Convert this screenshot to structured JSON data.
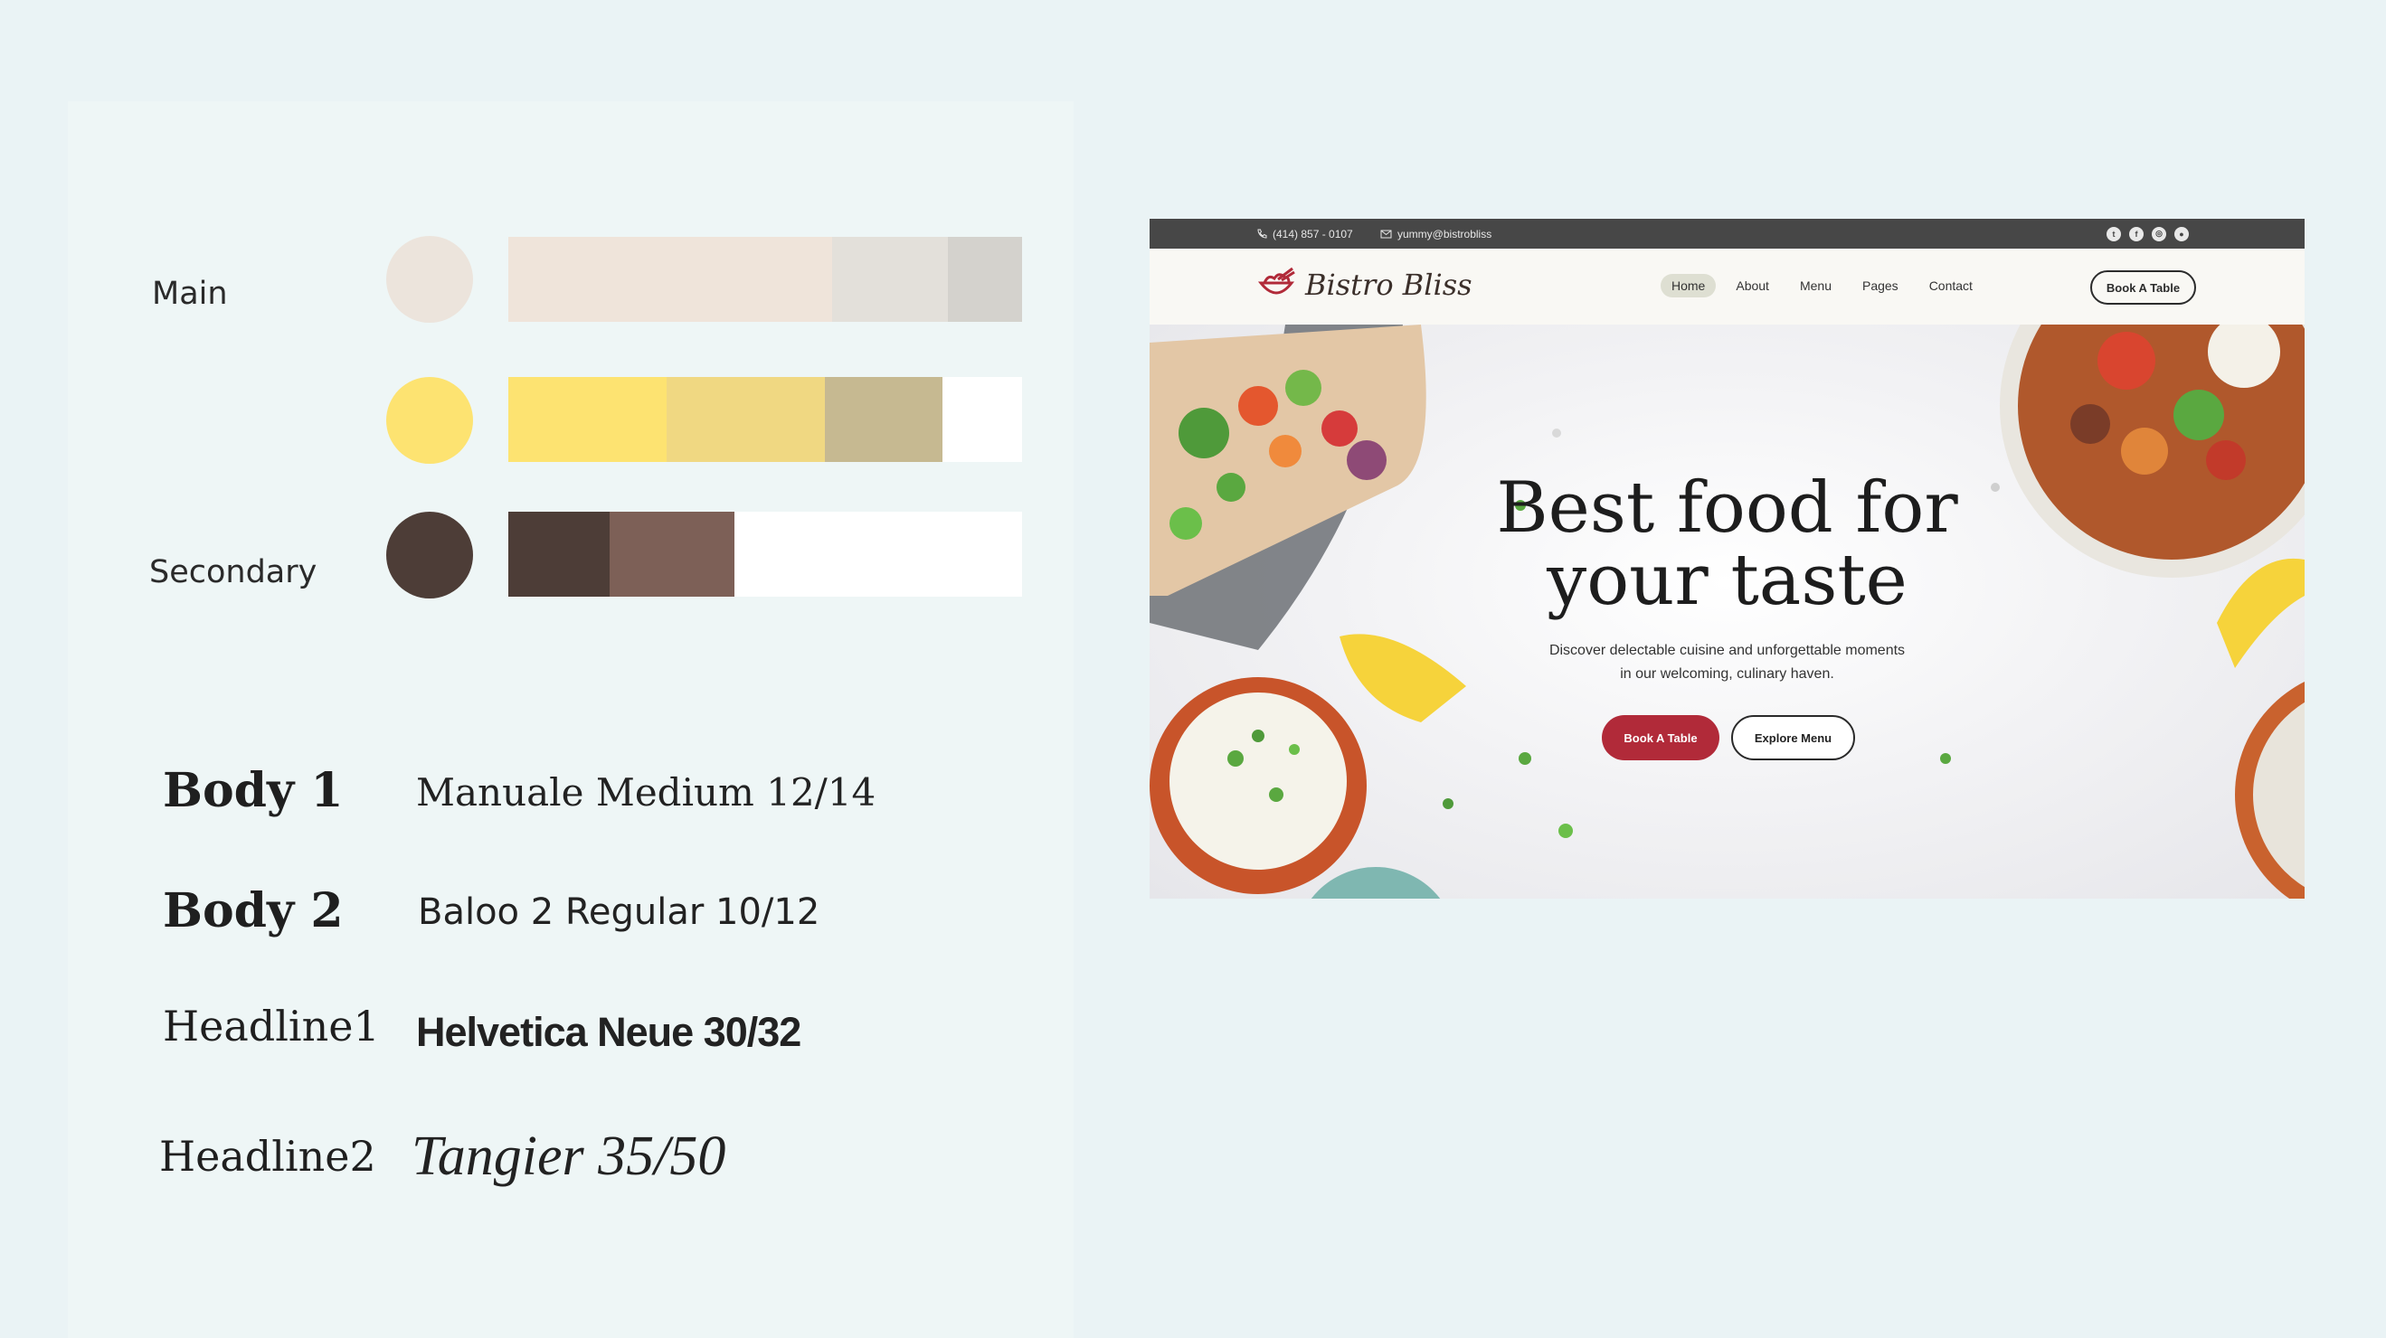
{
  "palette": {
    "main_label": "Main",
    "secondary_label": "Secondary",
    "rows": [
      {
        "circle": "#ece4dc",
        "swatches": [
          "#efe4da",
          "#e3e0da",
          "#d4d2cd"
        ]
      },
      {
        "circle": "#fde371",
        "swatches": [
          "#fde371",
          "#f0d882",
          "#c6b991",
          "#ffffff"
        ]
      },
      {
        "circle": "#4d3d37",
        "swatches": [
          "#4d3d37",
          "#7d6057",
          "#ffffff"
        ]
      }
    ]
  },
  "typography": [
    {
      "name": "Body 1",
      "spec": "Manuale Medium 12/14"
    },
    {
      "name": "Body 2",
      "spec": "Baloo 2 Regular 10/12"
    },
    {
      "name": "Headline1",
      "spec": "Helvetica Neue 30/32"
    },
    {
      "name": "Headline2",
      "spec": "Tangier 35/50"
    }
  ],
  "website": {
    "topbar": {
      "phone": "(414) 857 - 0107",
      "email": "yummy@bistrobliss",
      "socials": [
        "twitter-icon",
        "facebook-icon",
        "instagram-icon",
        "github-icon"
      ]
    },
    "brand": "Bistro Bliss",
    "nav": [
      "Home",
      "About",
      "Menu",
      "Pages",
      "Contact"
    ],
    "nav_cta": "Book A Table",
    "hero": {
      "title_line1": "Best food for",
      "title_line2": "your taste",
      "subtitle_line1": "Discover delectable cuisine and unforgettable moments",
      "subtitle_line2": "in our welcoming, culinary haven.",
      "primary_button": "Book A Table",
      "secondary_button": "Explore Menu"
    },
    "colors": {
      "accent": "#b12a39",
      "topbar": "#474747",
      "navbar": "#f9f8f4"
    }
  }
}
